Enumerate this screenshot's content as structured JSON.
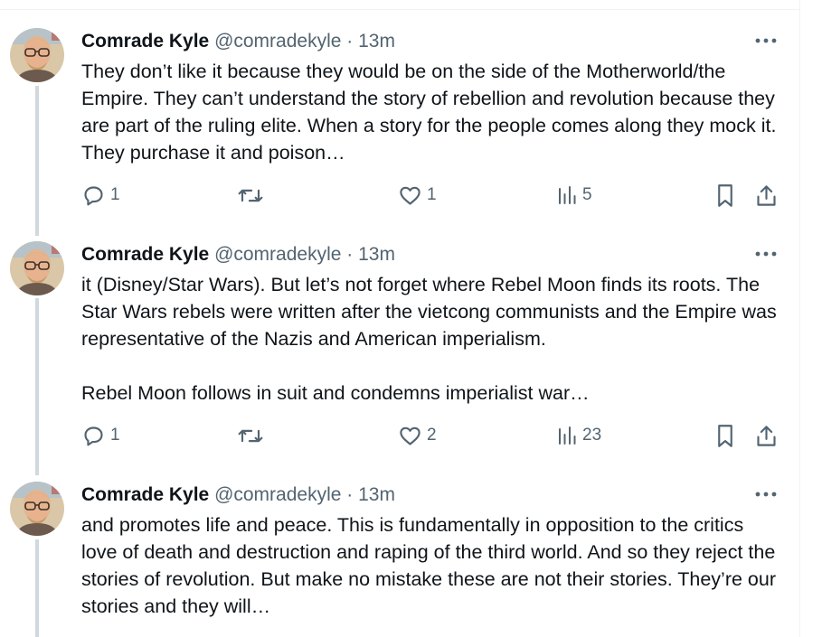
{
  "tweets": [
    {
      "name": "Comrade Kyle",
      "handle": "@comradekyle",
      "dot": "·",
      "time": "13m",
      "paragraphs": [
        "They don’t like it because they would be on the side of the Motherworld/the Empire. They can’t understand the story of rebellion and revolution because they are part of the ruling elite. When a story for the people comes along they mock it. They purchase it and poison…"
      ],
      "replies": "1",
      "retweets": "",
      "likes": "1",
      "views": "5"
    },
    {
      "name": "Comrade Kyle",
      "handle": "@comradekyle",
      "dot": "·",
      "time": "13m",
      "paragraphs": [
        "it (Disney/Star Wars). But let’s not forget where Rebel Moon finds its roots. The Star Wars rebels were written after the vietcong communists and the Empire was representative of the Nazis and American imperialism.",
        "Rebel Moon follows in suit and condemns imperialist war…"
      ],
      "replies": "1",
      "retweets": "",
      "likes": "2",
      "views": "23"
    },
    {
      "name": "Comrade Kyle",
      "handle": "@comradekyle",
      "dot": "·",
      "time": "13m",
      "paragraphs": [
        "and promotes life and peace. This is fundamentally in opposition to the critics love of death and destruction and raping of the third world. And so they reject the stories of revolution. But make no mistake these are not their stories. They’re our stories and they will…"
      ]
    }
  ],
  "icons": {
    "more": "more-horizontal-icon",
    "reply": "reply-icon",
    "retweet": "retweet-icon",
    "like": "heart-icon",
    "views": "views-icon",
    "bookmark": "bookmark-icon",
    "share": "share-icon",
    "thread_line_color": "#cfd9de",
    "muted_text_color": "#536471"
  }
}
